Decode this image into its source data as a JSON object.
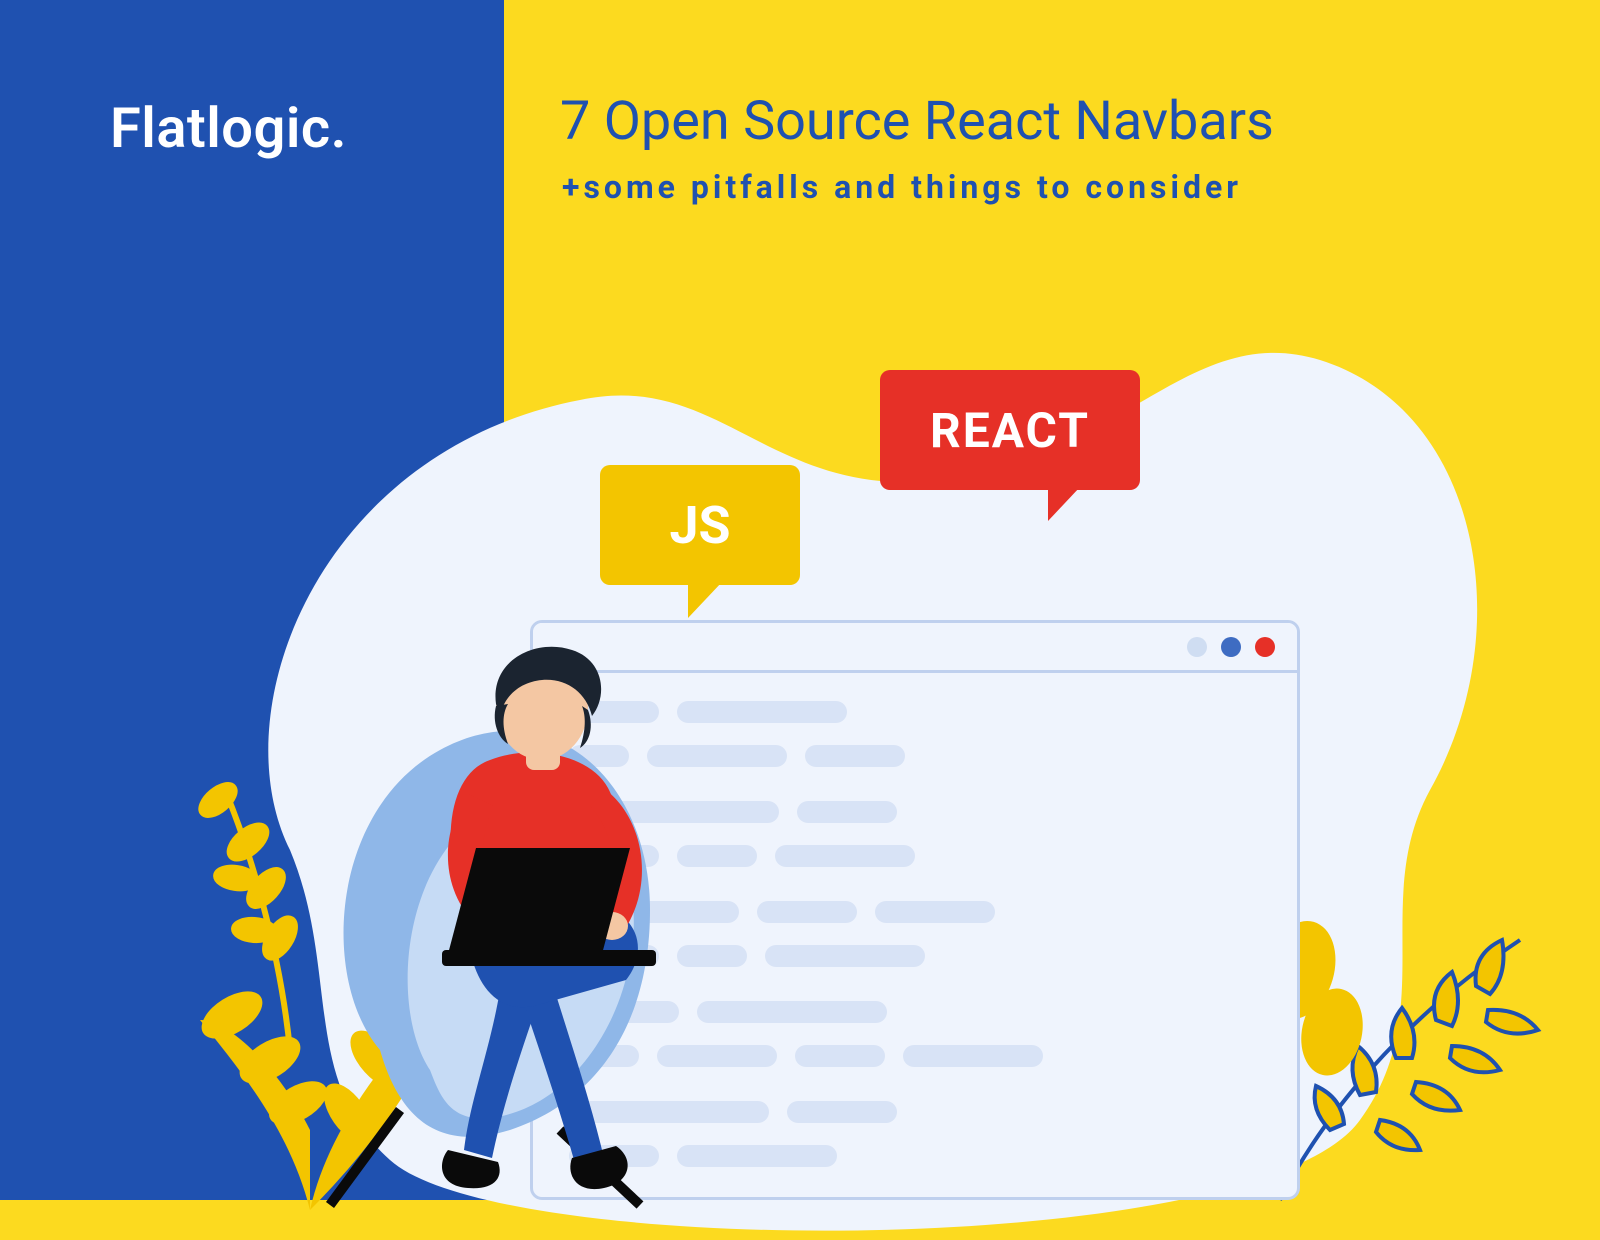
{
  "brand": "Flatlogic.",
  "title": "7 Open Source React Navbars",
  "subtitle": "+some pitfalls and things to consider",
  "bubbles": {
    "js": "JS",
    "react": "REACT"
  },
  "colors": {
    "blue": "#1F51B0",
    "yellow": "#FCDA1F",
    "red": "#E63027",
    "js_bubble": "#F3C500"
  }
}
